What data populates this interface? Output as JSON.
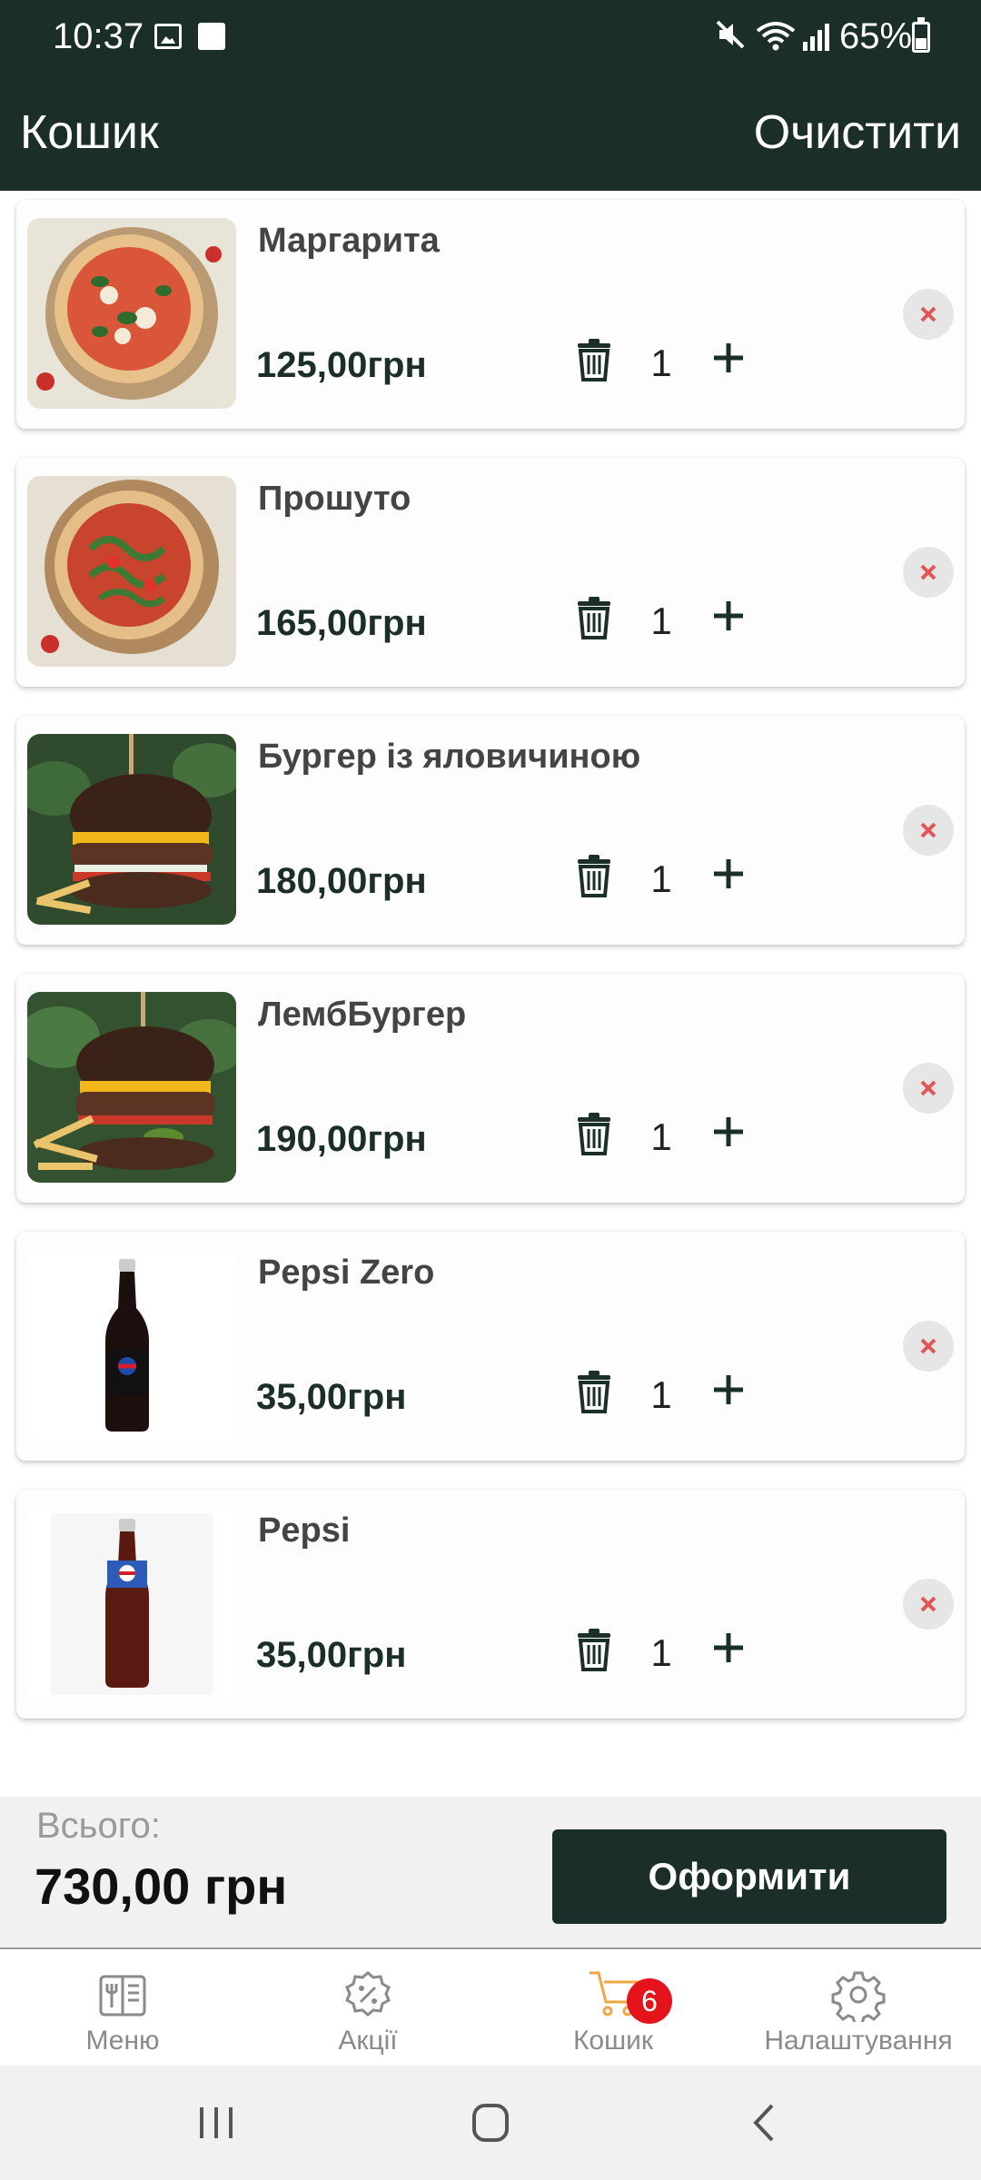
{
  "status_bar": {
    "time": "10:37",
    "battery": "65%"
  },
  "app_bar": {
    "title": "Кошик",
    "clear_label": "Очистити"
  },
  "cart_items": [
    {
      "name": "Маргарита",
      "price": "125,00грн",
      "quantity": "1",
      "image": "pizza-margherita"
    },
    {
      "name": "Прошуто",
      "price": "165,00грн",
      "quantity": "1",
      "image": "pizza-prosciutto"
    },
    {
      "name": "Бургер із яловичиною",
      "price": "180,00грн",
      "quantity": "1",
      "image": "beef-burger"
    },
    {
      "name": "ЛембБургер",
      "price": "190,00грн",
      "quantity": "1",
      "image": "lamb-burger"
    },
    {
      "name": "Pepsi Zero",
      "price": "35,00грн",
      "quantity": "1",
      "image": "pepsi-zero-bottle"
    },
    {
      "name": "Pepsi",
      "price": "35,00грн",
      "quantity": "1",
      "image": "pepsi-bottle"
    }
  ],
  "summary": {
    "label": "Всього:",
    "total": "730,00 грн",
    "checkout_label": "Оформити"
  },
  "bottom_nav": {
    "items": [
      {
        "label": "Меню",
        "icon": "menu-book-icon"
      },
      {
        "label": "Акції",
        "icon": "discount-icon"
      },
      {
        "label": "Кошик",
        "icon": "cart-icon",
        "badge": "6",
        "active": true
      },
      {
        "label": "Налаштування",
        "icon": "gear-icon"
      }
    ]
  },
  "colors": {
    "primary": "#1b2e2a",
    "accent": "#f0a742",
    "badge": "#e5141c",
    "remove": "#e05757"
  }
}
